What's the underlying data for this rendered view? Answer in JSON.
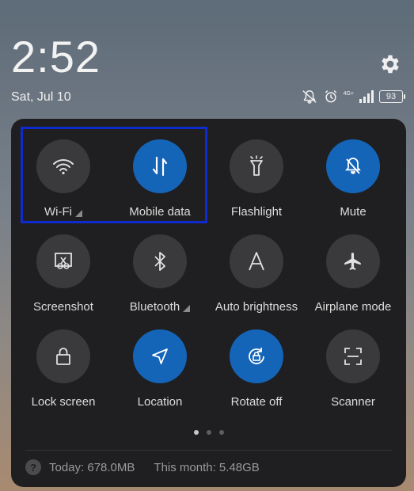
{
  "status": {
    "time": "2:52",
    "date": "Sat, Jul 10",
    "network": "4G+",
    "battery": "93"
  },
  "tiles": [
    {
      "label": "Wi-Fi",
      "icon": "wifi-icon",
      "active": false,
      "has_arrow": true
    },
    {
      "label": "Mobile data",
      "icon": "mobile-data-icon",
      "active": true,
      "has_arrow": false
    },
    {
      "label": "Flashlight",
      "icon": "flashlight-icon",
      "active": false,
      "has_arrow": false
    },
    {
      "label": "Mute",
      "icon": "mute-icon",
      "active": true,
      "has_arrow": false
    },
    {
      "label": "Screenshot",
      "icon": "screenshot-icon",
      "active": false,
      "has_arrow": false
    },
    {
      "label": "Bluetooth",
      "icon": "bluetooth-icon",
      "active": false,
      "has_arrow": true
    },
    {
      "label": "Auto brightness",
      "icon": "auto-brightness-icon",
      "active": false,
      "has_arrow": false
    },
    {
      "label": "Airplane mode",
      "icon": "airplane-icon",
      "active": false,
      "has_arrow": false
    },
    {
      "label": "Lock screen",
      "icon": "lock-icon",
      "active": false,
      "has_arrow": false
    },
    {
      "label": "Location",
      "icon": "location-icon",
      "active": true,
      "has_arrow": false
    },
    {
      "label": "Rotate off",
      "icon": "rotate-lock-icon",
      "active": true,
      "has_arrow": false
    },
    {
      "label": "Scanner",
      "icon": "scanner-icon",
      "active": false,
      "has_arrow": false
    }
  ],
  "usage": {
    "today": "Today: 678.0MB",
    "month": "This month: 5.48GB"
  },
  "colors": {
    "accent": "#1464b8",
    "panel": "#1f1f21",
    "highlight": "#0f2bd0"
  }
}
